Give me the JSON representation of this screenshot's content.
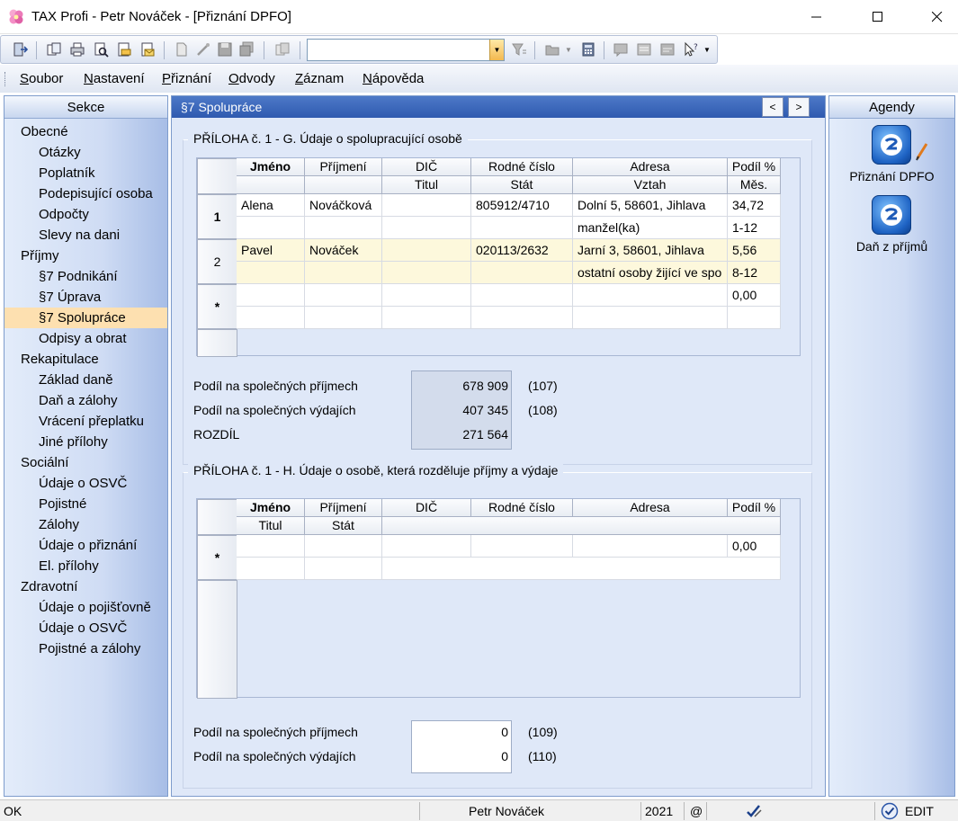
{
  "window": {
    "title": "TAX Profi - Petr Nováček - [Přiznání DPFO]"
  },
  "menu": [
    {
      "accel": "S",
      "rest": "oubor"
    },
    {
      "accel": "N",
      "rest": "astavení"
    },
    {
      "accel": "P",
      "rest": "řiznání"
    },
    {
      "accel": "O",
      "rest": "dvody"
    },
    {
      "accel": "Z",
      "rest": "áznam"
    },
    {
      "accel": "N",
      "rest": "ápověda"
    }
  ],
  "toolbar": {
    "combo_value": ""
  },
  "sidebar": {
    "title": "Sekce",
    "items": [
      {
        "label": "Obecné",
        "level": 0
      },
      {
        "label": "Otázky",
        "level": 1
      },
      {
        "label": "Poplatník",
        "level": 1
      },
      {
        "label": "Podepisující osoba",
        "level": 1
      },
      {
        "label": "Odpočty",
        "level": 1
      },
      {
        "label": "Slevy na dani",
        "level": 1
      },
      {
        "label": "Příjmy",
        "level": 0
      },
      {
        "label": "§7 Podnikání",
        "level": 1
      },
      {
        "label": "§7 Úprava",
        "level": 1
      },
      {
        "label": "§7 Spolupráce",
        "level": 1,
        "active": true
      },
      {
        "label": "Odpisy a obrat",
        "level": 1
      },
      {
        "label": "Rekapitulace",
        "level": 0
      },
      {
        "label": "Základ daně",
        "level": 1
      },
      {
        "label": "Daň a zálohy",
        "level": 1
      },
      {
        "label": "Vrácení přeplatku",
        "level": 1
      },
      {
        "label": "Jiné přílohy",
        "level": 1
      },
      {
        "label": "Sociální",
        "level": 0
      },
      {
        "label": "Údaje o OSVČ",
        "level": 1
      },
      {
        "label": "Pojistné",
        "level": 1
      },
      {
        "label": "Zálohy",
        "level": 1
      },
      {
        "label": "Údaje o přiznání",
        "level": 1
      },
      {
        "label": "El. přílohy",
        "level": 1
      },
      {
        "label": "Zdravotní",
        "level": 0
      },
      {
        "label": "Údaje o pojišťovně",
        "level": 1
      },
      {
        "label": "Údaje o OSVČ",
        "level": 1
      },
      {
        "label": "Pojistné a zálohy",
        "level": 1
      }
    ]
  },
  "main": {
    "title": "§7 Spolupráce",
    "prev": "<",
    "next": ">",
    "section_g": {
      "title": "PŘÍLOHA č. 1 - G. Údaje o spolupracující osobě",
      "headers_top": [
        "Jméno",
        "Příjmení",
        "DIČ",
        "Rodné číslo",
        "Adresa",
        "Podíl %"
      ],
      "headers_bottom": [
        "",
        "",
        "Titul",
        "Stát",
        "Vztah",
        "Měs."
      ],
      "rows": [
        {
          "no": "1",
          "a": [
            "Alena",
            "Nováčková",
            "",
            "805912/4710",
            "Dolní 5, 58601, Jihlava",
            "34,72"
          ],
          "b": [
            "",
            "",
            "",
            "",
            "manžel(ka)",
            "1-12"
          ]
        },
        {
          "no": "2",
          "a": [
            "Pavel",
            "Nováček",
            "",
            "020113/2632",
            "Jarní 3, 58601, Jihlava",
            "5,56"
          ],
          "b": [
            "",
            "",
            "",
            "",
            "ostatní osoby žijící ve spo",
            "8-12"
          ]
        },
        {
          "no": "*",
          "a": [
            "",
            "",
            "",
            "",
            "",
            "0,00"
          ],
          "b": [
            "",
            "",
            "",
            "",
            "",
            ""
          ]
        }
      ],
      "summary": [
        {
          "label": "Podíl na společných příjmech",
          "value": "678 909",
          "code": "(107)"
        },
        {
          "label": "Podíl na společných výdajích",
          "value": "407 345",
          "code": "(108)"
        },
        {
          "label": "ROZDÍL",
          "value": "271 564",
          "code": ""
        }
      ]
    },
    "section_h": {
      "title": "PŘÍLOHA č. 1 - H. Údaje o osobě, která rozděluje příjmy a výdaje",
      "headers_top": [
        "Jméno",
        "Příjmení",
        "DIČ",
        "Rodné číslo",
        "Adresa",
        "Podíl %"
      ],
      "headers_bottom": [
        "Titul",
        "Stát"
      ],
      "rows": [
        {
          "no": "*",
          "a": [
            "",
            "",
            "",
            "",
            "",
            "0,00"
          ]
        }
      ],
      "summary": [
        {
          "label": "Podíl na společných příjmech",
          "value": "0",
          "code": "(109)"
        },
        {
          "label": "Podíl na společných výdajích",
          "value": "0",
          "code": "(110)"
        }
      ]
    }
  },
  "agendy": {
    "title": "Agendy",
    "items": [
      {
        "label": "Přiznání DPFO"
      },
      {
        "label": "Daň z příjmů"
      }
    ]
  },
  "status": {
    "left": "OK",
    "user": "Petr Nováček",
    "year": "2021",
    "at": "@",
    "mode": "EDIT"
  }
}
